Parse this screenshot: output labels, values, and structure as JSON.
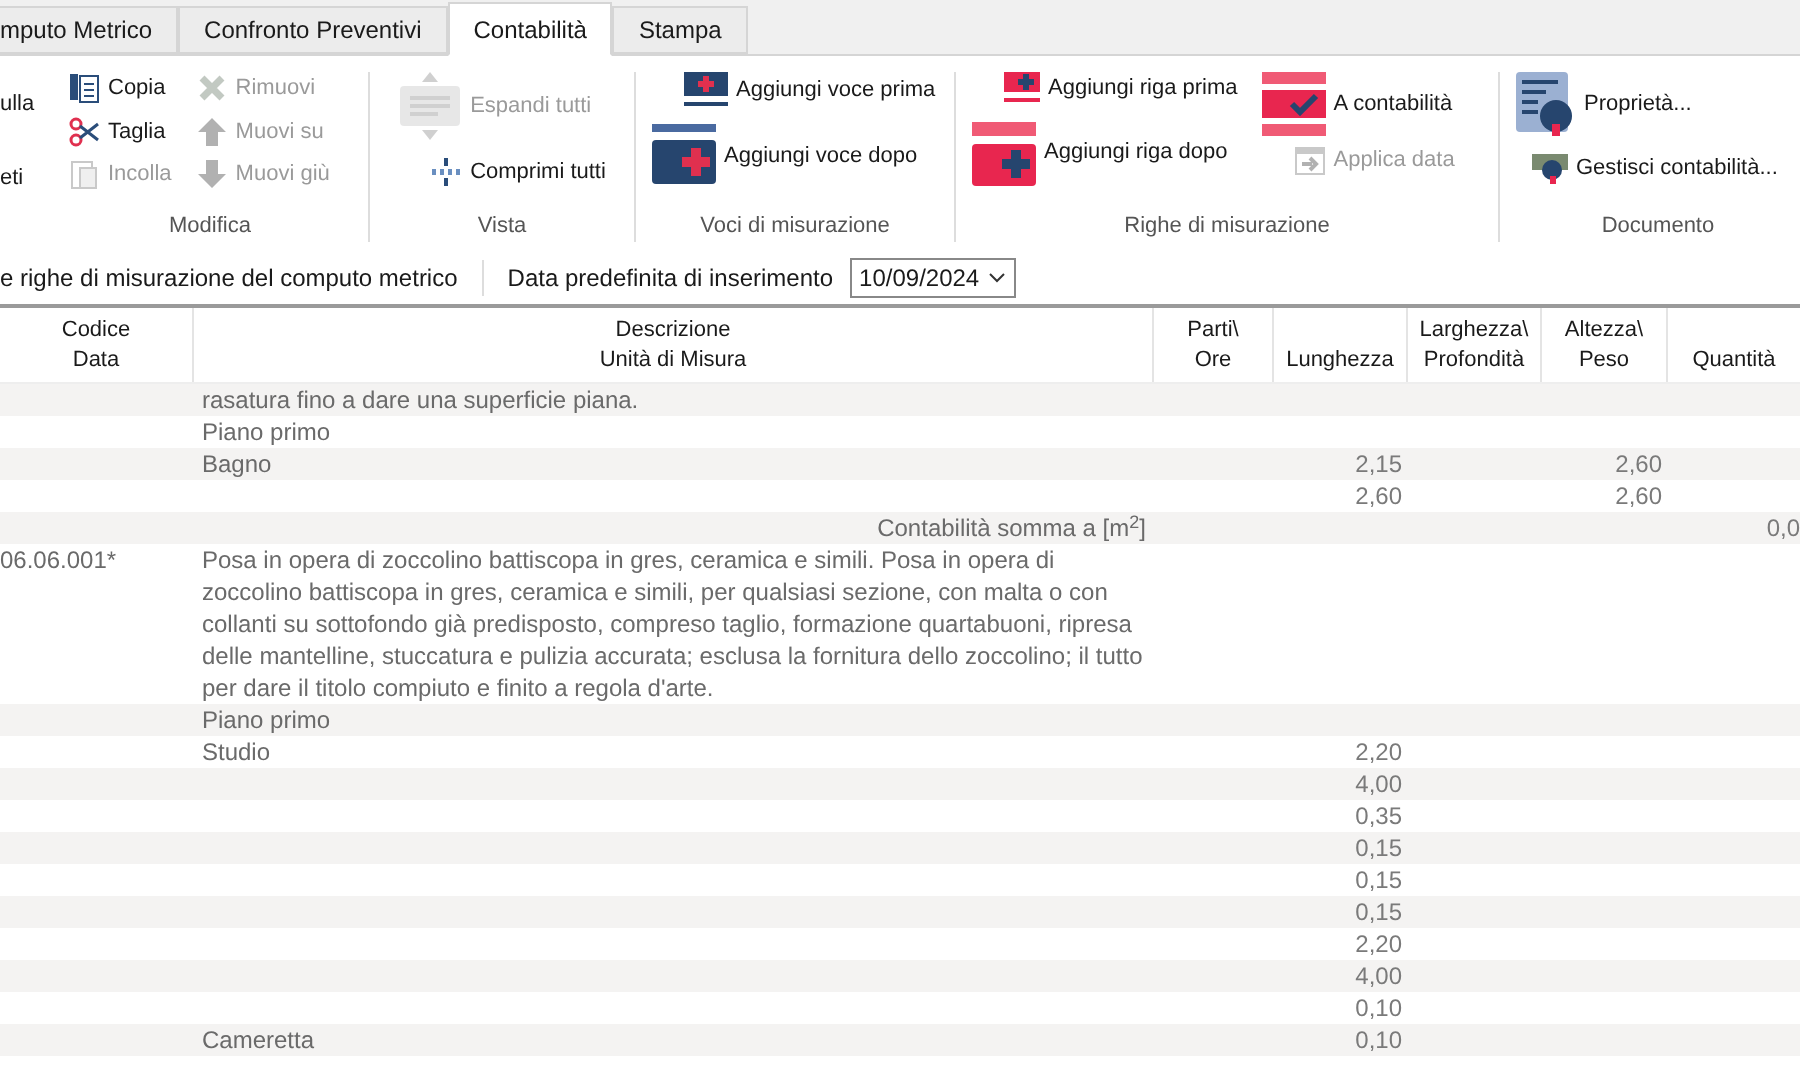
{
  "tabs": [
    {
      "label": "mputo Metrico",
      "selected": false
    },
    {
      "label": "Confronto Preventivi",
      "selected": false
    },
    {
      "label": "Contabilità",
      "selected": true
    },
    {
      "label": "Stampa",
      "selected": false
    }
  ],
  "ribbon": {
    "groups": [
      {
        "items": [
          {
            "kind": "cut",
            "label": "ulla",
            "disabled": false
          },
          {
            "kind": "cut",
            "label": "eti",
            "disabled": false
          }
        ]
      },
      {
        "label": "Modifica",
        "columns": [
          [
            {
              "kind": "copy",
              "label": "Copia",
              "disabled": false
            },
            {
              "kind": "scissors",
              "label": "Taglia",
              "disabled": false
            },
            {
              "kind": "paste",
              "label": "Incolla",
              "disabled": true
            }
          ],
          [
            {
              "kind": "remove",
              "label": "Rimuovi",
              "disabled": true
            },
            {
              "kind": "up",
              "label": "Muovi su",
              "disabled": true
            },
            {
              "kind": "down",
              "label": "Muovi giù",
              "disabled": true
            }
          ]
        ]
      },
      {
        "label": "Vista",
        "large": {
          "kind": "expand",
          "label": "Espandi tutti",
          "disabled": true
        },
        "small": {
          "kind": "collapse",
          "label": "Comprimi tutti",
          "disabled": false
        }
      },
      {
        "label": "Voci di misurazione",
        "items": [
          {
            "kind": "voce-before",
            "label": "Aggiungi voce prima",
            "disabled": false
          },
          {
            "kind": "voce-after",
            "label": "Aggiungi voce dopo",
            "disabled": false
          }
        ]
      },
      {
        "label": "Righe di misurazione",
        "columns": [
          [
            {
              "kind": "riga-before",
              "label": "Aggiungi riga prima",
              "disabled": false
            },
            {
              "kind": "riga-after",
              "label": "Aggiungi riga dopo",
              "disabled": false
            }
          ],
          [
            {
              "kind": "check",
              "label": "A contabilità",
              "disabled": false
            },
            {
              "kind": "date",
              "label": "Applica data",
              "disabled": true
            }
          ]
        ]
      },
      {
        "label": "Documento",
        "items": [
          {
            "kind": "props",
            "label": "Proprietà...",
            "disabled": false
          },
          {
            "kind": "manage",
            "label": "Gestisci contabilità...",
            "disabled": false
          }
        ]
      }
    ]
  },
  "options": {
    "note": "e righe di misurazione del computo metrico",
    "date_label": "Data predefinita di inserimento",
    "date_value": "10/09/2024"
  },
  "table": {
    "columns": [
      [
        "Codice",
        "Data"
      ],
      [
        "Descrizione",
        "Unità di Misura"
      ],
      [
        "Parti\\",
        "Ore"
      ],
      [
        "",
        "Lunghezza"
      ],
      [
        "Larghezza\\",
        "Profondità"
      ],
      [
        "Altezza\\",
        "Peso"
      ],
      [
        "",
        "Quantità"
      ]
    ],
    "rows": [
      {
        "kind": "line",
        "desc": "rasatura fino a dare una superficie piana."
      },
      {
        "kind": "line",
        "desc": "Piano primo"
      },
      {
        "kind": "line",
        "desc": "Bagno",
        "lunghezza": "2,15",
        "altezza": "2,60"
      },
      {
        "kind": "line",
        "lunghezza": "2,60",
        "altezza": "2,60"
      },
      {
        "kind": "sum",
        "desc": "Contabilità somma a [m$^{2}$]",
        "quantita": "0,0"
      },
      {
        "kind": "item",
        "code": "06.06.001*",
        "desc": "Posa in opera di zoccolino battiscopa in gres, ceramica e simili. Posa in opera di zoccolino battiscopa in gres, ceramica e simili, per qualsiasi sezione, con malta o con collanti su sottofondo già predisposto, compreso taglio, formazione quartabuoni, ripresa delle mantelline, stuccatura e pulizia accurata; esclusa la fornitura dello zoccolino; il tutto per dare il titolo compiuto e finito a regola d'arte."
      },
      {
        "kind": "line",
        "desc": "Piano primo"
      },
      {
        "kind": "line",
        "desc": "Studio",
        "lunghezza": "2,20"
      },
      {
        "kind": "line",
        "lunghezza": "4,00"
      },
      {
        "kind": "line",
        "lunghezza": "0,35"
      },
      {
        "kind": "line",
        "lunghezza": "0,15"
      },
      {
        "kind": "line",
        "lunghezza": "0,15"
      },
      {
        "kind": "line",
        "lunghezza": "0,15"
      },
      {
        "kind": "line",
        "lunghezza": "2,20"
      },
      {
        "kind": "line",
        "lunghezza": "4,00"
      },
      {
        "kind": "line",
        "lunghezza": "0,10"
      },
      {
        "kind": "line",
        "desc": "Cameretta",
        "lunghezza": "0,10"
      }
    ]
  }
}
